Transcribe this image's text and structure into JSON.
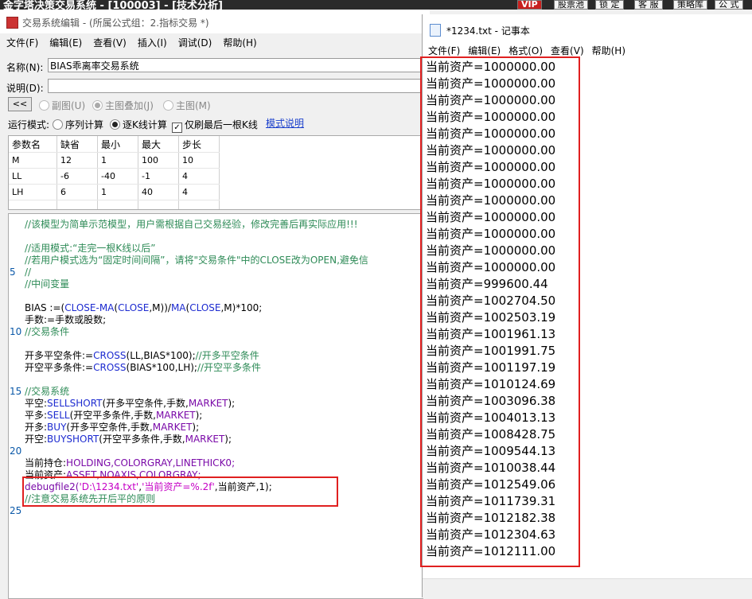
{
  "app": {
    "title": "金字塔决策交易系统 - [100003] - [技术分析]",
    "buttons": [
      "VIP",
      "股票池",
      "锁 定",
      "客 服",
      "策略库",
      "公 式"
    ]
  },
  "editor": {
    "title": "交易系统编辑 - (所属公式组：2.指标交易 *)",
    "menu": [
      "文件(F)",
      "编辑(E)",
      "查看(V)",
      "插入(I)",
      "调试(D)",
      "帮助(H)"
    ],
    "name_label": "名称(N):",
    "name_value": "BIAS乖离率交易系统",
    "desc_label": "说明(D):",
    "desc_value": "",
    "collapse_button": "<<",
    "chart_options": [
      {
        "label": "副图(U)",
        "selected": false
      },
      {
        "label": "主图叠加(J)",
        "selected": true
      },
      {
        "label": "主图(M)",
        "selected": false
      }
    ],
    "run_mode_label": "运行模式:",
    "run_modes": [
      {
        "label": "序列计算",
        "selected": false
      },
      {
        "label": "逐K线计算",
        "selected": true
      }
    ],
    "last_bar_only_label": "仅刷最后一根K线",
    "last_bar_only_checked": "✓",
    "mode_help_link": "模式说明",
    "params": {
      "headers": [
        "参数名",
        "缺省",
        "最小",
        "最大",
        "步长"
      ],
      "rows": [
        [
          "M",
          "12",
          "1",
          "100",
          "10"
        ],
        [
          "LL",
          "-6",
          "-40",
          "-1",
          "4"
        ],
        [
          "LH",
          "6",
          "1",
          "40",
          "4"
        ]
      ]
    },
    "line_numbers": [
      "5",
      "10",
      "15",
      "20",
      "25"
    ],
    "code": {
      "l1": "//该模型为简单示范模型，用户需根据自己交易经验，修改完善后再实际应用!!!",
      "l3": "//适用模式:“走完一根K线以后”",
      "l4": "//若用户模式选为“固定时间间隔”，请将\"交易条件\"中的CLOSE改为OPEN,避免信",
      "l5": "//",
      "l6": "//中间变量",
      "l8a": "BIAS :=(",
      "l8b": "CLOSE",
      "l8c": "-",
      "l8d": "MA",
      "l8e": "(",
      "l8f": "CLOSE",
      "l8g": ",M))/",
      "l8h": "MA",
      "l8i": "(",
      "l8j": "CLOSE",
      "l8k": ",M)*100;",
      "l9": "手数:=手数或股数;",
      "l10": "//交易条件",
      "l12a": "开多平空条件:=",
      "l12b": "CROSS",
      "l12c": "(LL,BIAS*100);",
      "l12d": "//开多平空条件",
      "l13a": "开空平多条件:=",
      "l13b": "CROSS",
      "l13c": "(BIAS*100,LH);",
      "l13d": "//开空平多条件",
      "l15": "//交易系统",
      "l16a": "平空:",
      "l16b": "SELLSHORT",
      "l16c": "(开多平空条件,手数,",
      "l16d": "MARKET",
      "l16e": ");",
      "l17a": "平多:",
      "l17b": "SELL",
      "l17c": "(开空平多条件,手数,",
      "l17d": "MARKET",
      "l17e": ");",
      "l18a": "开多:",
      "l18b": "BUY",
      "l18c": "(开多平空条件,手数,",
      "l18d": "MARKET",
      "l18e": ");",
      "l19a": "开空:",
      "l19b": "BUYSHORT",
      "l19c": "(开空平多条件,手数,",
      "l19d": "MARKET",
      "l19e": ");",
      "l21a": "当前持仓:",
      "l21b": "HOLDING,COLORGRAY,LINETHICK0;",
      "l22a": "当前资产:",
      "l22b": "ASSET,NOAXIS,COLORGRAY;",
      "l23a": "debugfile2(",
      "l23b": "'D:\\1234.txt'",
      "l23c": ",",
      "l23d": "'当前资产=%.2f'",
      "l23e": ",当前资产,1);",
      "l24": "//注意交易系统先开后平的原则"
    }
  },
  "notepad": {
    "title": "*1234.txt - 记事本",
    "menu": [
      "文件(F)",
      "编辑(E)",
      "格式(O)",
      "查看(V)",
      "帮助(H)"
    ],
    "lines": [
      "当前资产=1000000.00",
      "当前资产=1000000.00",
      "当前资产=1000000.00",
      "当前资产=1000000.00",
      "当前资产=1000000.00",
      "当前资产=1000000.00",
      "当前资产=1000000.00",
      "当前资产=1000000.00",
      "当前资产=1000000.00",
      "当前资产=1000000.00",
      "当前资产=1000000.00",
      "当前资产=1000000.00",
      "当前资产=1000000.00",
      "当前资产=999600.44",
      "当前资产=1002704.50",
      "当前资产=1002503.19",
      "当前资产=1001961.13",
      "当前资产=1001991.75",
      "当前资产=1001197.19",
      "当前资产=1010124.69",
      "当前资产=1003096.38",
      "当前资产=1004013.13",
      "当前资产=1008428.75",
      "当前资产=1009544.13",
      "当前资产=1010038.44",
      "当前资产=1012549.06",
      "当前资产=1011739.31",
      "当前资产=1012182.38",
      "当前资产=1012304.63",
      "当前资产=1012111.00"
    ]
  },
  "colors": {
    "highlight_box": "#e02020",
    "comment": "#2e8b57",
    "keyword": "#1d2bd0",
    "string": "#c500c5",
    "line_number": "#0a58a8"
  }
}
